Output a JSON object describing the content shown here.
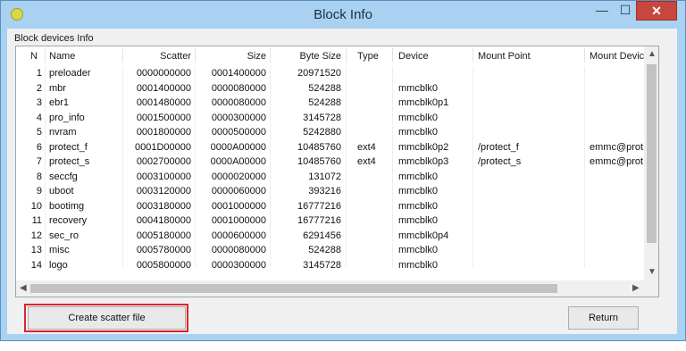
{
  "window": {
    "title": "Block Info"
  },
  "titlebar": {
    "minimize": "—",
    "maximize": "☐",
    "close": "✕"
  },
  "group_label": "Block devices Info",
  "columns": {
    "n": "N",
    "name": "Name",
    "scatter": "Scatter",
    "size": "Size",
    "byte_size": "Byte Size",
    "type": "Type",
    "device": "Device",
    "mount_point": "Mount Point",
    "mount_device": "Mount Devic"
  },
  "rows": [
    {
      "n": "1",
      "name": "preloader",
      "scatter": "0000000000",
      "size": "0001400000",
      "byte_size": "20971520",
      "type": "",
      "device": "",
      "mount_point": "",
      "mount_device": ""
    },
    {
      "n": "2",
      "name": "mbr",
      "scatter": "0001400000",
      "size": "0000080000",
      "byte_size": "524288",
      "type": "",
      "device": "mmcblk0",
      "mount_point": "",
      "mount_device": ""
    },
    {
      "n": "3",
      "name": "ebr1",
      "scatter": "0001480000",
      "size": "0000080000",
      "byte_size": "524288",
      "type": "",
      "device": "mmcblk0p1",
      "mount_point": "",
      "mount_device": ""
    },
    {
      "n": "4",
      "name": "pro_info",
      "scatter": "0001500000",
      "size": "0000300000",
      "byte_size": "3145728",
      "type": "",
      "device": "mmcblk0",
      "mount_point": "",
      "mount_device": ""
    },
    {
      "n": "5",
      "name": "nvram",
      "scatter": "0001800000",
      "size": "0000500000",
      "byte_size": "5242880",
      "type": "",
      "device": "mmcblk0",
      "mount_point": "",
      "mount_device": ""
    },
    {
      "n": "6",
      "name": "protect_f",
      "scatter": "0001D00000",
      "size": "0000A00000",
      "byte_size": "10485760",
      "type": "ext4",
      "device": "mmcblk0p2",
      "mount_point": "/protect_f",
      "mount_device": "emmc@prot"
    },
    {
      "n": "7",
      "name": "protect_s",
      "scatter": "0002700000",
      "size": "0000A00000",
      "byte_size": "10485760",
      "type": "ext4",
      "device": "mmcblk0p3",
      "mount_point": "/protect_s",
      "mount_device": "emmc@prot"
    },
    {
      "n": "8",
      "name": "seccfg",
      "scatter": "0003100000",
      "size": "0000020000",
      "byte_size": "131072",
      "type": "",
      "device": "mmcblk0",
      "mount_point": "",
      "mount_device": ""
    },
    {
      "n": "9",
      "name": "uboot",
      "scatter": "0003120000",
      "size": "0000060000",
      "byte_size": "393216",
      "type": "",
      "device": "mmcblk0",
      "mount_point": "",
      "mount_device": ""
    },
    {
      "n": "10",
      "name": "bootimg",
      "scatter": "0003180000",
      "size": "0001000000",
      "byte_size": "16777216",
      "type": "",
      "device": "mmcblk0",
      "mount_point": "",
      "mount_device": ""
    },
    {
      "n": "11",
      "name": "recovery",
      "scatter": "0004180000",
      "size": "0001000000",
      "byte_size": "16777216",
      "type": "",
      "device": "mmcblk0",
      "mount_point": "",
      "mount_device": ""
    },
    {
      "n": "12",
      "name": "sec_ro",
      "scatter": "0005180000",
      "size": "0000600000",
      "byte_size": "6291456",
      "type": "",
      "device": "mmcblk0p4",
      "mount_point": "",
      "mount_device": ""
    },
    {
      "n": "13",
      "name": "misc",
      "scatter": "0005780000",
      "size": "0000080000",
      "byte_size": "524288",
      "type": "",
      "device": "mmcblk0",
      "mount_point": "",
      "mount_device": ""
    },
    {
      "n": "14",
      "name": "logo",
      "scatter": "0005800000",
      "size": "0000300000",
      "byte_size": "3145728",
      "type": "",
      "device": "mmcblk0",
      "mount_point": "",
      "mount_device": ""
    }
  ],
  "buttons": {
    "create_scatter": "Create scatter file",
    "return": "Return"
  },
  "colors": {
    "titlebar": "#a9d1f1",
    "close": "#c7463d",
    "highlight": "#e0242b"
  }
}
